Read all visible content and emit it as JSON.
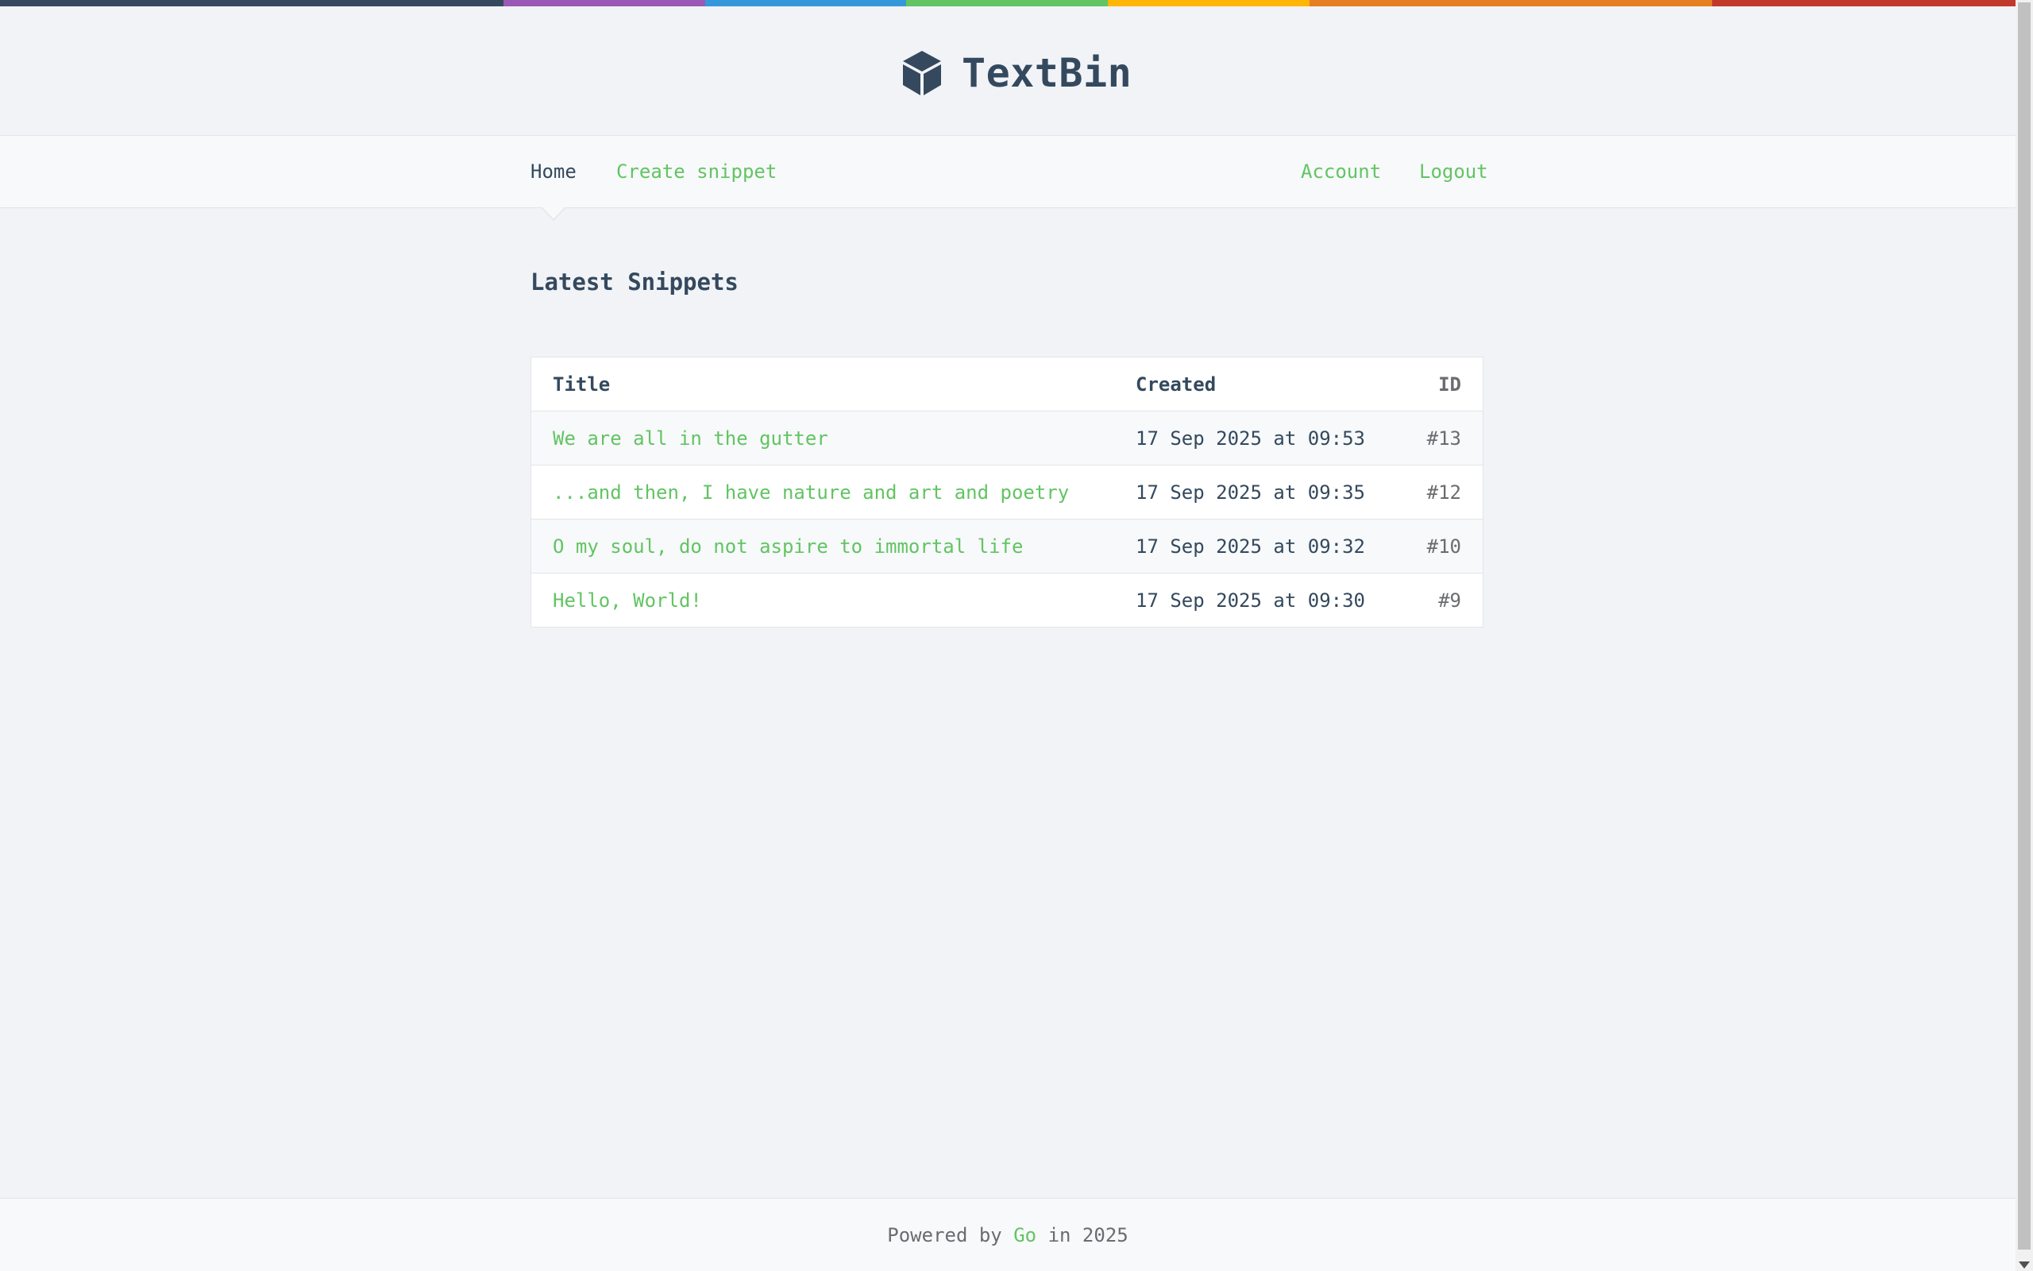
{
  "theme": {
    "accent": "#62c462",
    "text": "#34495e",
    "muted": "#6a6c6f",
    "background": "#f1f3f7",
    "rainbow": [
      "#34495e",
      "#9b59b6",
      "#3498db",
      "#62c462",
      "#ffb606",
      "#e67e22",
      "#c0392b"
    ]
  },
  "header": {
    "logo_icon": "cube-icon",
    "title": "TextBin"
  },
  "nav": {
    "home": "Home",
    "create": "Create snippet",
    "account": "Account",
    "logout": "Logout",
    "active": "Home"
  },
  "main": {
    "title": "Latest Snippets",
    "columns": {
      "title": "Title",
      "created": "Created",
      "id": "ID"
    },
    "rows": [
      {
        "title": "We are all in the gutter",
        "created": "17 Sep 2025 at 09:53",
        "id": "#13"
      },
      {
        "title": "...and then, I have nature and art and poetry",
        "created": "17 Sep 2025 at 09:35",
        "id": "#12"
      },
      {
        "title": "O my soul, do not aspire to immortal life",
        "created": "17 Sep 2025 at 09:32",
        "id": "#10"
      },
      {
        "title": "Hello, World!",
        "created": "17 Sep 2025 at 09:30",
        "id": "#9"
      }
    ]
  },
  "footer": {
    "prefix": "Powered by",
    "link": "Go",
    "suffix": "in 2025"
  }
}
